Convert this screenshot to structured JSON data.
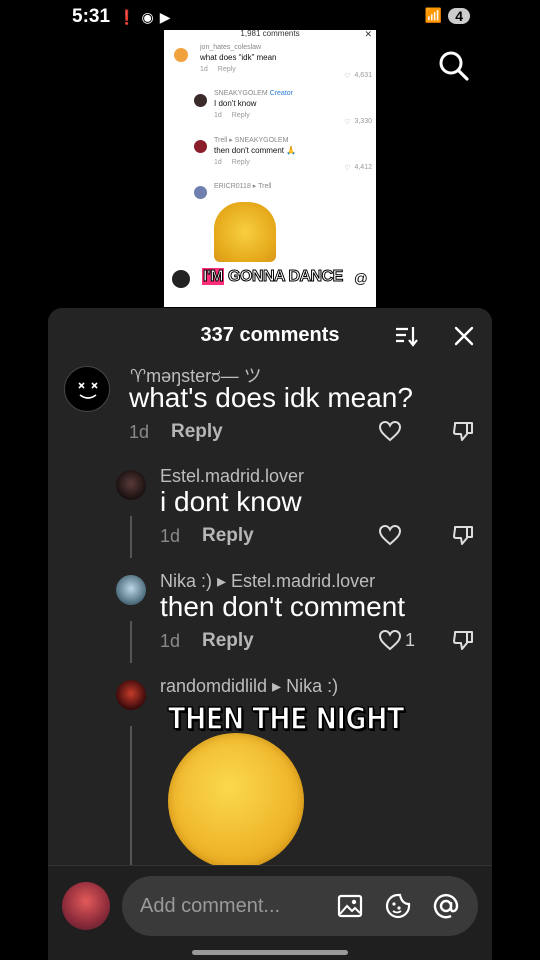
{
  "status_bar": {
    "time": "5:31",
    "notification_count": "4"
  },
  "embedded_screenshot": {
    "header": "1,981 comments",
    "comments": [
      {
        "user": "jon_hates_coleslaw",
        "text": "what does “idk” mean",
        "time": "1d",
        "reply": "Reply",
        "likes": "4,631"
      },
      {
        "user": "SNEAKYGOLEM",
        "tag": "Creator",
        "text": "I don't know",
        "time": "1d",
        "reply": "Reply",
        "likes": "3,330"
      },
      {
        "user": "Trell ▸ SNEAKYGOLEM",
        "text": "then don't comment 🙏",
        "time": "1d",
        "reply": "Reply",
        "likes": "4,412"
      },
      {
        "user": "ERICR0118 ▸ Trell",
        "text": "",
        "time": "",
        "reply": "",
        "likes": ""
      }
    ],
    "overlay_highlight": "I'M",
    "overlay_text": "GONNA DANCE",
    "at_icon": "@"
  },
  "sheet": {
    "title": "337 comments",
    "comments": [
      {
        "user": "♈məŋsterರ—  ツ",
        "text": "what's does idk mean?",
        "time": "1d",
        "reply": "Reply",
        "likes": ""
      },
      {
        "user": "Estel.madrid.lover",
        "text": "i dont know",
        "time": "1d",
        "reply": "Reply",
        "likes": ""
      },
      {
        "user": "Nika :) ▸ Estel.madrid.lover",
        "text": "then don't comment",
        "time": "1d",
        "reply": "Reply",
        "likes": "1"
      },
      {
        "user": "randomdidlild ▸ Nika :)",
        "text": "",
        "time": "",
        "reply": "",
        "likes": ""
      }
    ],
    "caption_overlay": "THEN THE NIGHT",
    "input_placeholder": "Add comment..."
  },
  "colors": {
    "sheet_bg": "#242424",
    "accent_creator": "#2b7bd7",
    "highlight": "#ff2e7a"
  }
}
